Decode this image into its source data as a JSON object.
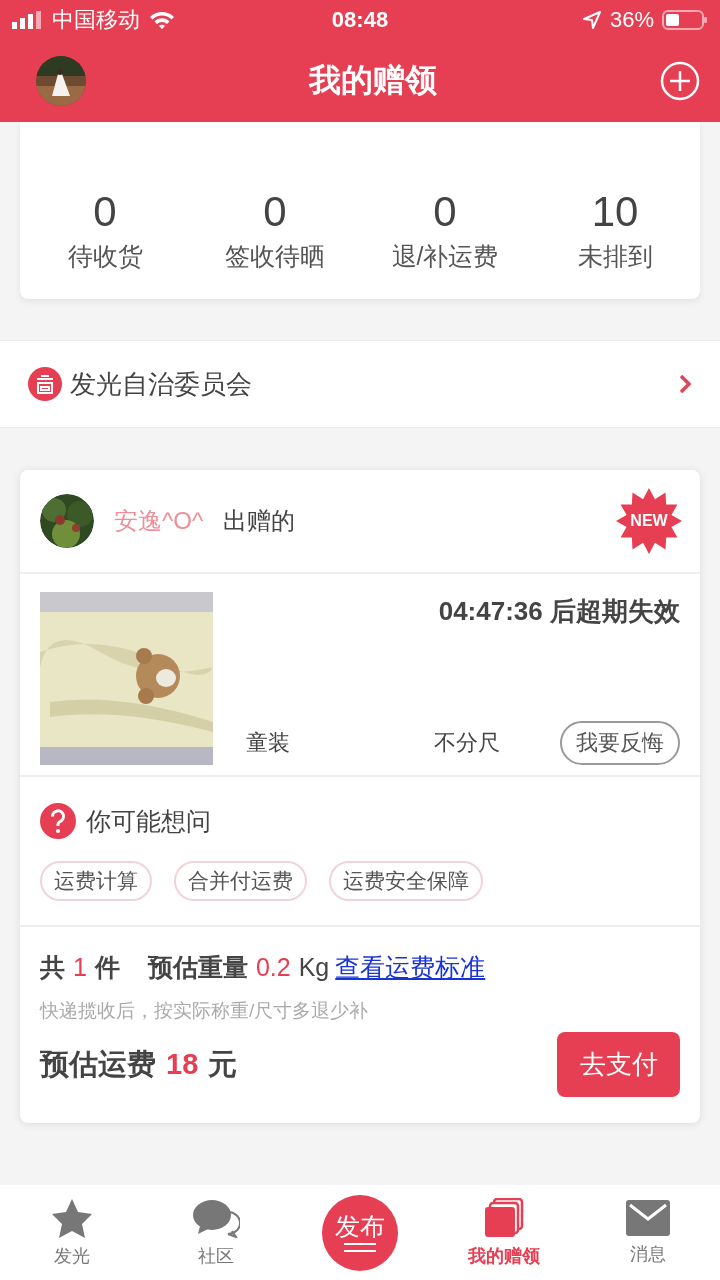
{
  "status_bar": {
    "carrier": "中国移动",
    "time": "08:48",
    "battery": "36%"
  },
  "header": {
    "title": "我的赠领"
  },
  "counts": [
    {
      "value": "0",
      "label": "待收货"
    },
    {
      "value": "0",
      "label": "签收待晒"
    },
    {
      "value": "0",
      "label": "退/补运费"
    },
    {
      "value": "10",
      "label": "未排到"
    }
  ],
  "committee": {
    "label": "发光自治委员会"
  },
  "gift": {
    "giver": "安逸^O^",
    "giver_suffix": "出赠的",
    "badge": "NEW",
    "countdown": "04:47:36 后超期失效",
    "category": "童装",
    "size": "不分尺",
    "regret_button": "我要反悔",
    "faq_title": "你可能想问",
    "faq_tags": [
      "运费计算",
      "合并付运费",
      "运费安全保障"
    ],
    "count_prefix": "共",
    "count": "1",
    "count_suffix": "件",
    "weight_label": "预估重量",
    "weight": "0.2",
    "weight_unit": "Kg",
    "standard_link": "查看运费标准",
    "note": "快递揽收后，按实际称重/尺寸多退少补",
    "fee_label": "预估运费",
    "fee": "18",
    "fee_unit": "元",
    "pay_button": "去支付"
  },
  "tabs": [
    {
      "kind": "star",
      "label": "发光",
      "selected": false
    },
    {
      "kind": "chat",
      "label": "社区",
      "selected": false
    },
    {
      "kind": "publish",
      "label": "发布",
      "selected": false
    },
    {
      "kind": "book",
      "label": "我的赠领",
      "selected": true
    },
    {
      "kind": "mail",
      "label": "消息",
      "selected": false
    }
  ]
}
